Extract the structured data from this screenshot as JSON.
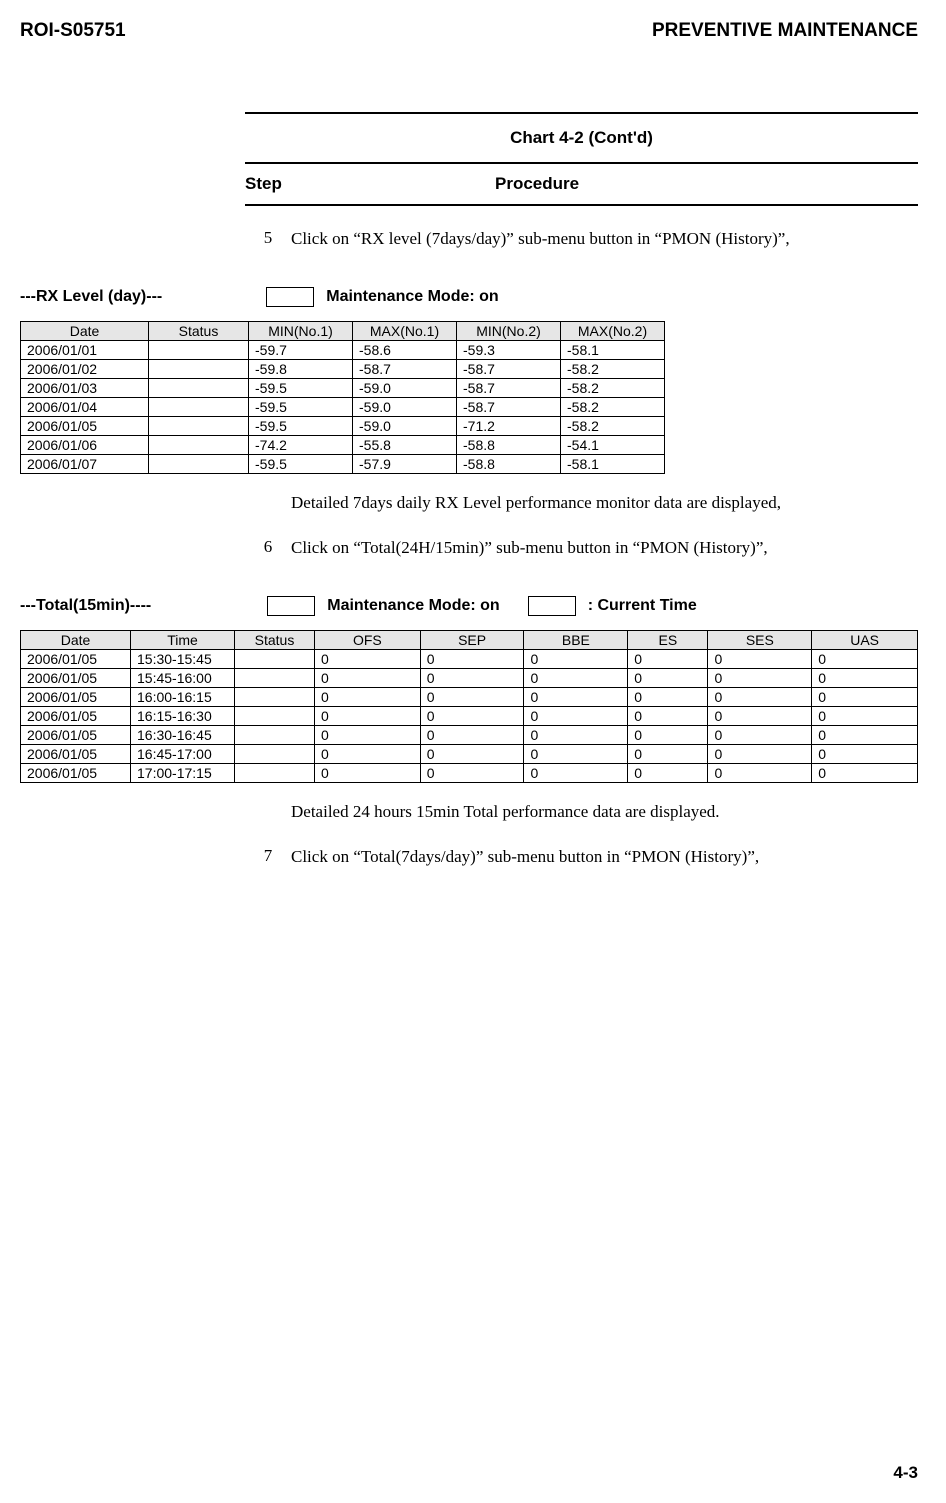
{
  "header": {
    "doc_id": "ROI-S05751",
    "title": "PREVENTIVE MAINTENANCE"
  },
  "chart_title": "Chart 4-2  (Cont'd)",
  "step_header": {
    "step": "Step",
    "procedure": "Procedure"
  },
  "steps": [
    {
      "num": "5",
      "text": "Click on “RX level (7days/day)” sub-menu button in “PMON (History)”,"
    },
    {
      "num": "6",
      "text": "Click on “Total(24H/15min)” sub-menu button in “PMON (History)”,"
    },
    {
      "num": "7",
      "text": "Click on “Total(7days/day)” sub-menu button in “PMON (History)”,"
    }
  ],
  "section1": {
    "label": "---RX Level (day)---",
    "mode": "Maintenance Mode: on"
  },
  "table1": {
    "headers": [
      "Date",
      "Status",
      "MIN(No.1)",
      "MAX(No.1)",
      "MIN(No.2)",
      "MAX(No.2)"
    ],
    "rows": [
      [
        "2006/01/01",
        "",
        "-59.7",
        "-58.6",
        "-59.3",
        "-58.1"
      ],
      [
        "2006/01/02",
        "",
        "-59.8",
        "-58.7",
        "-58.7",
        "-58.2"
      ],
      [
        "2006/01/03",
        "",
        "-59.5",
        "-59.0",
        "-58.7",
        "-58.2"
      ],
      [
        "2006/01/04",
        "",
        "-59.5",
        "-59.0",
        "-58.7",
        "-58.2"
      ],
      [
        "2006/01/05",
        "",
        "-59.5",
        "-59.0",
        "-71.2",
        "-58.2"
      ],
      [
        "2006/01/06",
        "",
        "-74.2",
        "-55.8",
        "-58.8",
        "-54.1"
      ],
      [
        "2006/01/07",
        "",
        "-59.5",
        "-57.9",
        "-58.8",
        "-58.1"
      ]
    ]
  },
  "para1": "Detailed 7days daily RX Level performance monitor data are displayed,",
  "section2": {
    "label": "---Total(15min)----",
    "mode": "Maintenance Mode: on",
    "current": ": Current Time"
  },
  "table2": {
    "headers": [
      "Date",
      "Time",
      "Status",
      "OFS",
      "SEP",
      "BBE",
      "ES",
      "SES",
      "UAS"
    ],
    "rows": [
      [
        "2006/01/05",
        "15:30-15:45",
        "",
        "0",
        "0",
        "0",
        "0",
        "0",
        "0"
      ],
      [
        "2006/01/05",
        "15:45-16:00",
        "",
        "0",
        "0",
        "0",
        "0",
        "0",
        "0"
      ],
      [
        "2006/01/05",
        "16:00-16:15",
        "",
        "0",
        "0",
        "0",
        "0",
        "0",
        "0"
      ],
      [
        "2006/01/05",
        "16:15-16:30",
        "",
        "0",
        "0",
        "0",
        "0",
        "0",
        "0"
      ],
      [
        "2006/01/05",
        "16:30-16:45",
        "",
        "0",
        "0",
        "0",
        "0",
        "0",
        "0"
      ],
      [
        "2006/01/05",
        "16:45-17:00",
        "",
        "0",
        "0",
        "0",
        "0",
        "0",
        "0"
      ],
      [
        "2006/01/05",
        "17:00-17:15",
        "",
        "0",
        "0",
        "0",
        "0",
        "0",
        "0"
      ]
    ]
  },
  "para2": "Detailed 24 hours 15min Total performance data are displayed.",
  "page_num": "4-3"
}
